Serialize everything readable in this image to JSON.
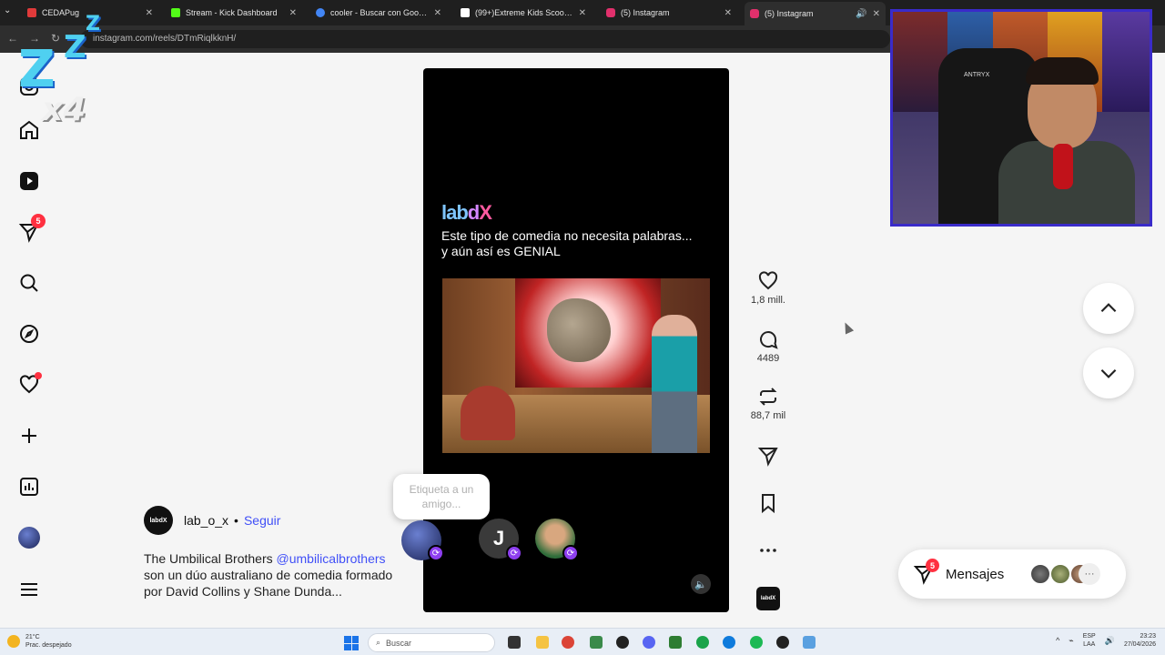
{
  "browser": {
    "tabs": [
      {
        "label": "CEDAPug",
        "color": "#e03a3a"
      },
      {
        "label": "Stream - Kick Dashboard",
        "color": "#53fc18"
      },
      {
        "label": "cooler - Buscar con Google",
        "color": "#4285f4"
      },
      {
        "label": "(99+)Extreme Kids Scooter Tric",
        "color": "#ffffff"
      },
      {
        "label": "(5) Instagram",
        "color": "#e1306c"
      },
      {
        "label": "(5) Instagram",
        "color": "#e1306c"
      }
    ],
    "url": "instagram.com/reels/DTmRiqlkknH/"
  },
  "overlay": {
    "z1": "Z",
    "z2": "Z",
    "z3": "Z",
    "multiplier": "x4"
  },
  "sidebar": {
    "notifications_badge": "5"
  },
  "reel": {
    "brand": {
      "p1": "lab",
      "p2": "d",
      "p3": "X"
    },
    "caption_line1": "Este tipo de comedia no necesita palabras...",
    "caption_line2": "y aún así es GENIAL",
    "tag_prompt": "Etiqueta a un amigo...",
    "share_contact_initial": "J",
    "audio_thumb_label": "labdX"
  },
  "actions": {
    "likes": "1,8 mill.",
    "comments": "4489",
    "reposts": "88,7 mil"
  },
  "author": {
    "avatar_label": "labdX",
    "name": "lab_o_x",
    "separator": "•",
    "follow_label": "Seguir"
  },
  "description": {
    "part1": "The Umbilical Brothers ",
    "mention": "@umbilicalbrothers",
    "part2": " son un dúo australiano de comedia formado por David Collins y Shane Dunda..."
  },
  "messages": {
    "label": "Mensajes",
    "badge": "5",
    "more": "···"
  },
  "webcam": {
    "chair_brand": "ANTRYX"
  },
  "taskbar": {
    "temperature": "21°C",
    "weather_text": "Prac. despejado",
    "search_placeholder": "Buscar",
    "lang_line1": "ESP",
    "lang_line2": "LAA",
    "time": "23:23",
    "date": "27/04/2026"
  },
  "colors": {
    "accent_link": "#4150f7",
    "badge_red": "#ff3040",
    "webcam_border": "#3a2bc9"
  }
}
